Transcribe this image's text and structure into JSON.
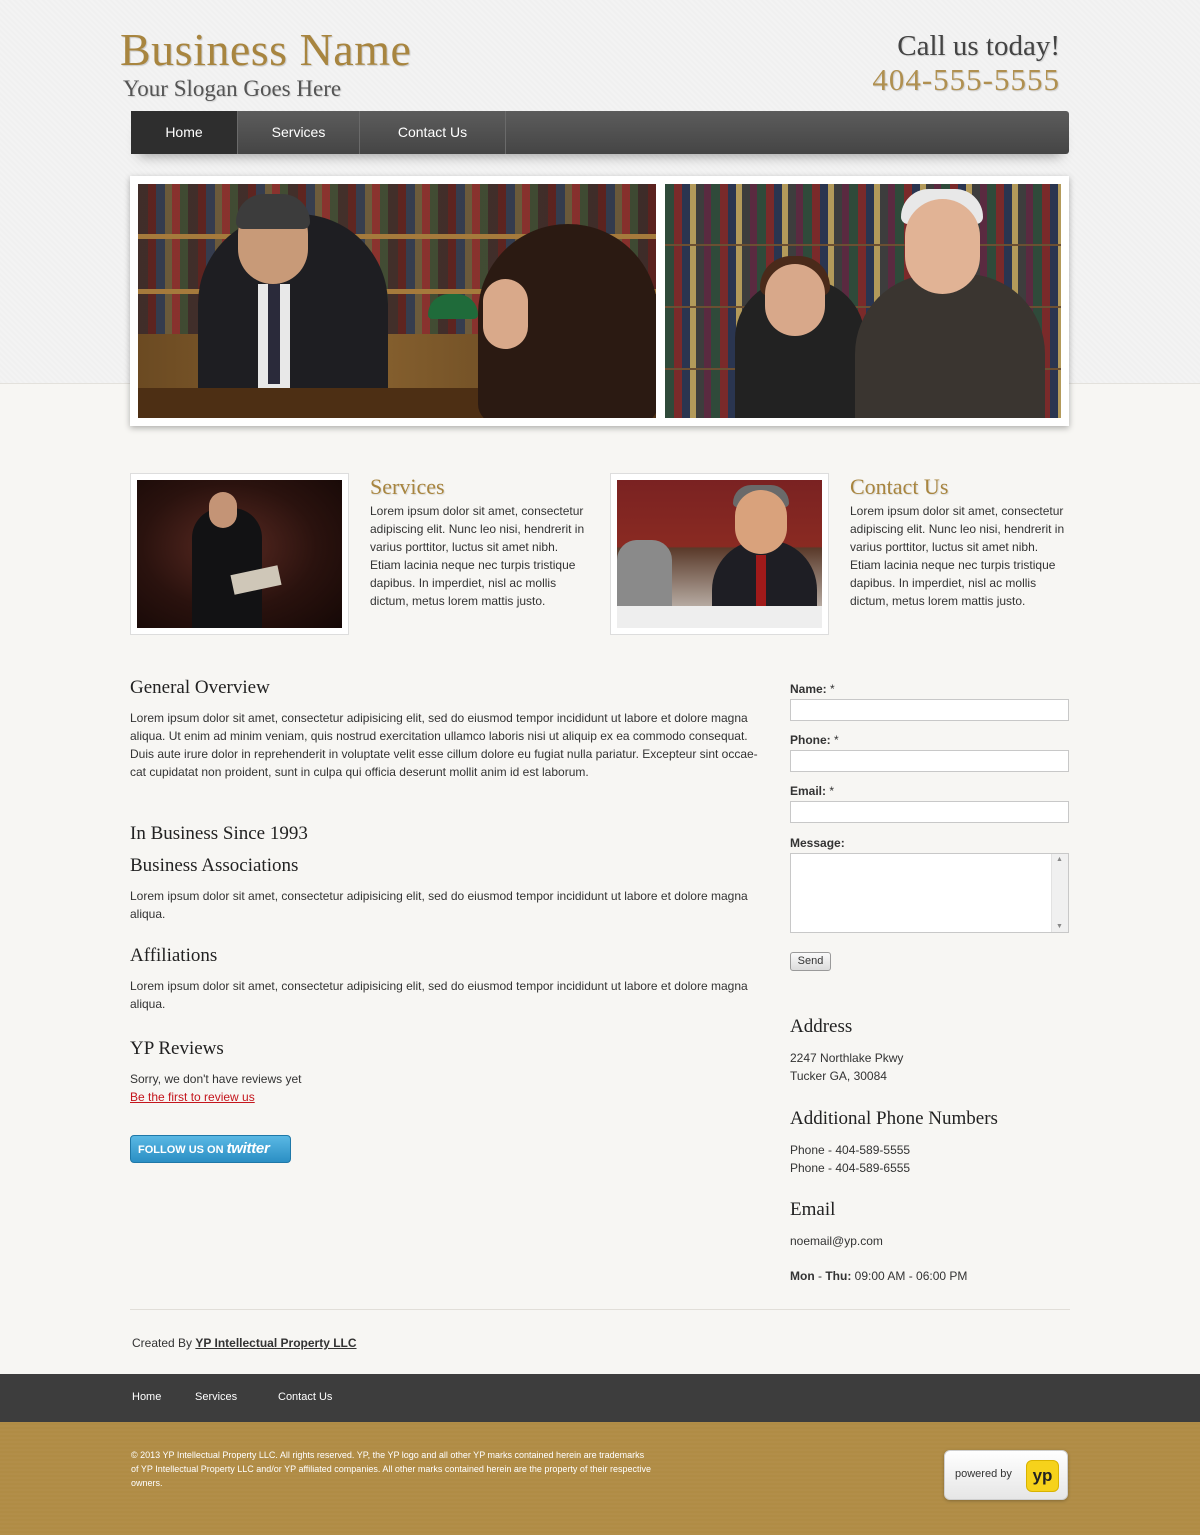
{
  "header": {
    "business_name": "Business Name",
    "slogan": "Your Slogan Goes Here",
    "call_text": "Call us today!",
    "phone": "404-555-5555"
  },
  "nav": {
    "items": [
      {
        "label": "Home",
        "active": true
      },
      {
        "label": "Services",
        "active": false
      },
      {
        "label": "Contact Us",
        "active": false
      }
    ]
  },
  "features": [
    {
      "title": "Services",
      "body": "Lorem ipsum dolor sit amet, consectetur adipiscing elit. Nunc leo nisi, hendrerit in varius porttitor, luctus sit amet nibh. Etiam lacinia neque nec turpis tristique dapibus. In imperdiet, nisl ac mollis dictum, metus lorem mattis justo."
    },
    {
      "title": "Contact Us",
      "body": "Lorem ipsum dolor sit amet, consectetur adipiscing elit. Nunc leo nisi, hendrerit in varius porttitor, luctus sit amet nibh. Etiam lacinia neque nec turpis tristique dapibus. In imperdiet, nisl ac mollis dictum, metus lorem mattis justo."
    }
  ],
  "main": {
    "overview_title": "General Overview",
    "overview_body": "Lorem ipsum dolor sit amet, consectetur adipisicing elit, sed do eiusmod tempor incididunt ut labore et dolore magna aliqua. Ut enim ad minim veniam, quis nostrud exercitation ullamco laboris nisi ut aliquip ex ea commodo consequat. Duis aute irure dolor in reprehenderit in voluptate velit esse cillum dolore eu fugiat nulla pariatur. Excepteur sint occae-cat cupidatat non proident, sunt in culpa qui officia deserunt mollit anim id est laborum.",
    "since_title": "In Business Since 1993",
    "associations_title": "Business Associations",
    "associations_body": "Lorem ipsum dolor sit amet, consectetur adipisicing elit, sed do eiusmod tempor incididunt ut labore et dolore magna aliqua.",
    "affiliations_title": "Affiliations",
    "affiliations_body": "Lorem ipsum dolor sit amet, consectetur adipisicing elit, sed do eiusmod tempor incididunt ut labore et dolore magna aliqua.",
    "reviews_title": "YP Reviews",
    "reviews_empty": "Sorry, we don't have reviews yet",
    "reviews_link": "Be the first to review us",
    "twitter_prefix": "FOLLOW US ON",
    "twitter_word": "twitter"
  },
  "form": {
    "name_label": "Name:",
    "phone_label": "Phone:",
    "email_label": "Email:",
    "message_label": "Message:",
    "required_mark": "*",
    "send_label": "Send"
  },
  "info": {
    "address_title": "Address",
    "address_line1": "2247 Northlake Pkwy",
    "address_line2": "Tucker GA, 30084",
    "phones_title": "Additional Phone Numbers",
    "phone1": "Phone - 404-589-5555",
    "phone2": "Phone - 404-589-6555",
    "email_title": "Email",
    "email": "noemail@yp.com",
    "hours_days": "Mon",
    "hours_sep": " - ",
    "hours_days_end": "Thu:",
    "hours_time": " 09:00 AM - 06:00 PM"
  },
  "footer": {
    "created_by": "Created By",
    "created_link": "YP Intellectual Property LLC",
    "nav": [
      "Home",
      "Services",
      "Contact Us"
    ],
    "copyright": "© 2013  YP Intellectual Property LLC. All rights reserved. YP, the YP logo and all other YP marks contained herein are trademarks of YP Intellectual Property LLC and/or YP affiliated companies. All other marks contained herein are the property of their respective owners.",
    "powered_by": "powered by",
    "yp_logo": "yp"
  },
  "colors": {
    "gold": "#b08c45",
    "brand_text": "#a8853f",
    "nav_bg": "#4f4f4f",
    "link_red": "#c4151c"
  }
}
